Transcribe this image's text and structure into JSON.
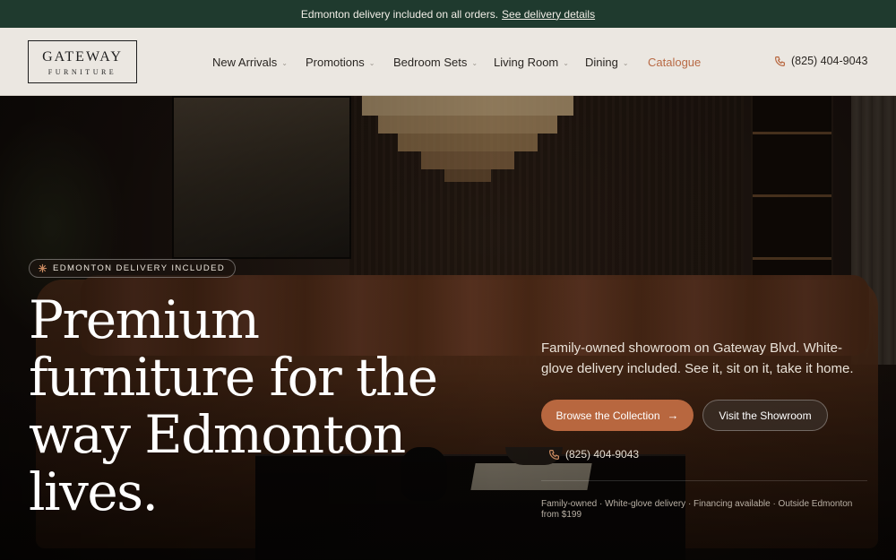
{
  "announcement": {
    "text": "Edmonton delivery included on all orders.",
    "link": "See delivery details"
  },
  "header": {
    "logo_main": "GATEWAY",
    "logo_sub": "FURNITURE",
    "nav": [
      {
        "label": "New Arrivals",
        "has_dropdown": true
      },
      {
        "label": "Promotions",
        "has_dropdown": true
      },
      {
        "label": "Bedroom Sets",
        "has_dropdown": true
      },
      {
        "label": "Living Room",
        "has_dropdown": true
      },
      {
        "label": "Dining",
        "has_dropdown": true
      },
      {
        "label": "Catalogue",
        "has_dropdown": false
      }
    ],
    "phone": "(825) 404-9043",
    "phone_icon": "phone-icon"
  },
  "hero": {
    "badge": "EDMONTON DELIVERY INCLUDED",
    "badge_icon": "sparkle-icon",
    "headline": "Premium furniture for the way Edmonton lives.",
    "subtext": "Family-owned showroom on Gateway Blvd. White-glove delivery included. See it, sit on it, take it home.",
    "primary_button": "Browse the Collection",
    "primary_button_icon": "arrow-right-icon",
    "secondary_button": "Visit the Showroom",
    "phone": "(825) 404-9043",
    "meta": "Family-owned · White-glove delivery · Financing available · Outside Edmonton from $199"
  },
  "colors": {
    "announcement_bg": "#1f3a2e",
    "header_bg": "#ebe7e1",
    "accent": "#b8673f",
    "catalogue_link": "#b86a45"
  }
}
